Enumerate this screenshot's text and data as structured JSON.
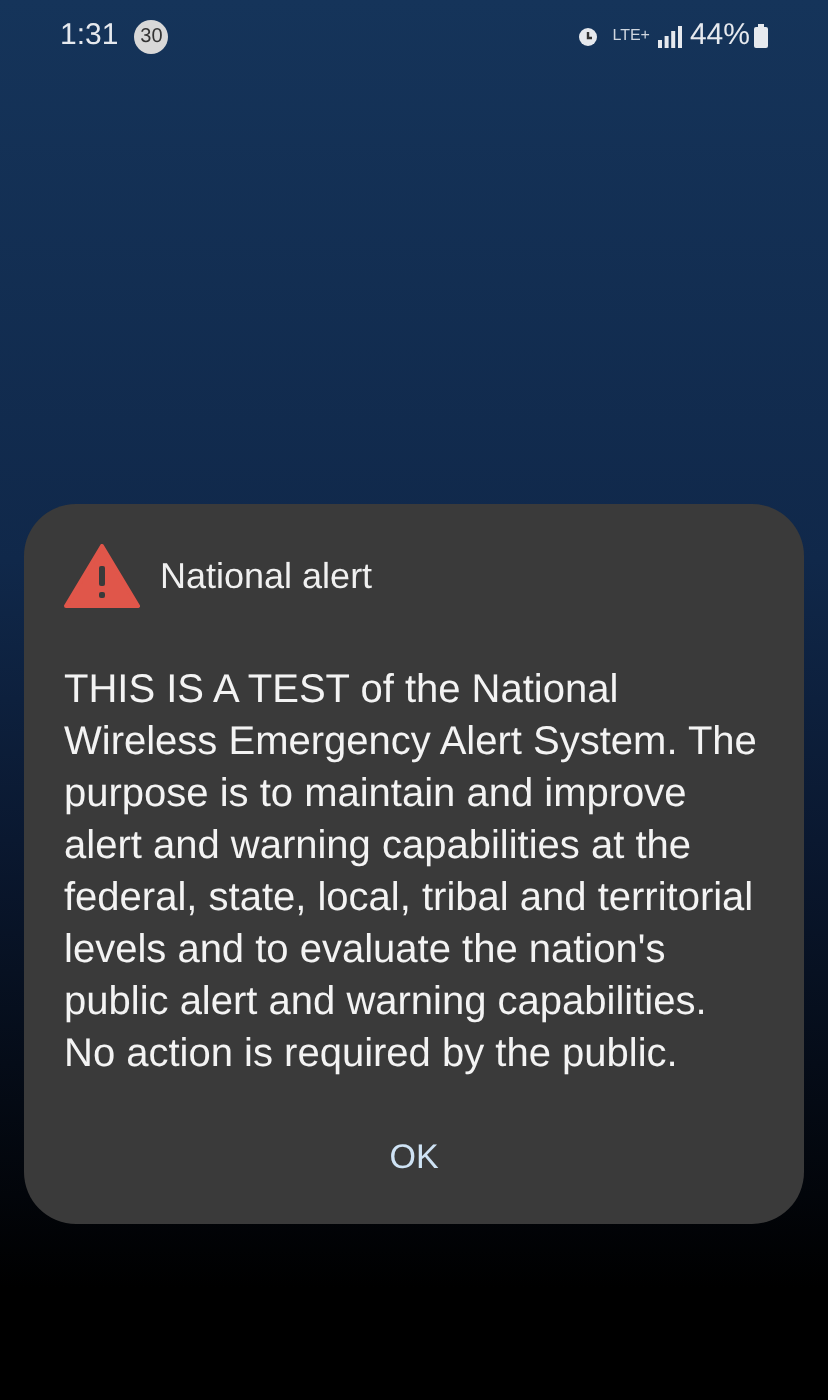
{
  "status_bar": {
    "time": "1:31",
    "notification_count": "30",
    "network": "LTE+",
    "battery": "44%"
  },
  "dialog": {
    "title": "National alert",
    "message": "THIS IS A TEST of the National Wireless Emergency Alert System. The purpose is to maintain and improve alert and warning capabilities at the federal, state, local, tribal and territorial levels and to evaluate the nation's public alert and warning capabilities. No action is required by the public.",
    "buttons": [
      "OK"
    ]
  }
}
